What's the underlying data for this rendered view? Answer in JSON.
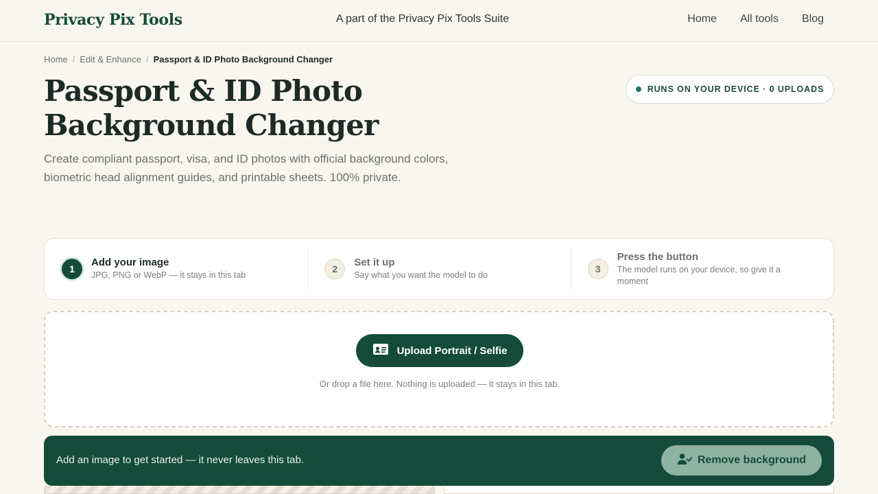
{
  "header": {
    "brand": "Privacy Pix Tools",
    "suite_text": "A part of the Privacy Pix Tools Suite",
    "nav": [
      {
        "label": "Home"
      },
      {
        "label": "All tools"
      },
      {
        "label": "Blog"
      }
    ]
  },
  "breadcrumb": {
    "items": [
      "Home",
      "Edit & Enhance"
    ],
    "separator": "/",
    "current": "Passport & ID Photo Background Changer"
  },
  "page": {
    "title": "Passport & ID Photo Background Changer",
    "subtitle": "Create compliant passport, visa, and ID photos with official background colors, biometric head alignment guides, and printable sheets. 100% private."
  },
  "badge": {
    "text": "RUNS ON YOUR DEVICE · 0 UPLOADS",
    "dot_color": "#1e7a5a"
  },
  "steps": [
    {
      "number": "1",
      "title": "Add your image",
      "desc": "JPG, PNG or WebP — it stays in this tab",
      "active": true
    },
    {
      "number": "2",
      "title": "Set it up",
      "desc": "Say what you want the model to do",
      "active": false
    },
    {
      "number": "3",
      "title": "Press the button",
      "desc": "The model runs on your device, so give it a moment",
      "active": false
    }
  ],
  "dropzone": {
    "button_label": "Upload Portrait / Selfie",
    "button_icon": "id-card-icon",
    "hint": "Or drop a file here. Nothing is uploaded — it stays in this tab."
  },
  "actionbar": {
    "message": "Add an image to get started — it never leaves this tab.",
    "button_label": "Remove background",
    "button_icon": "user-check-icon"
  },
  "colors": {
    "brand_green": "#154b3a",
    "background": "#f9f6f0",
    "muted_text": "#6b716e",
    "disabled_button": "#8fb3a3"
  }
}
